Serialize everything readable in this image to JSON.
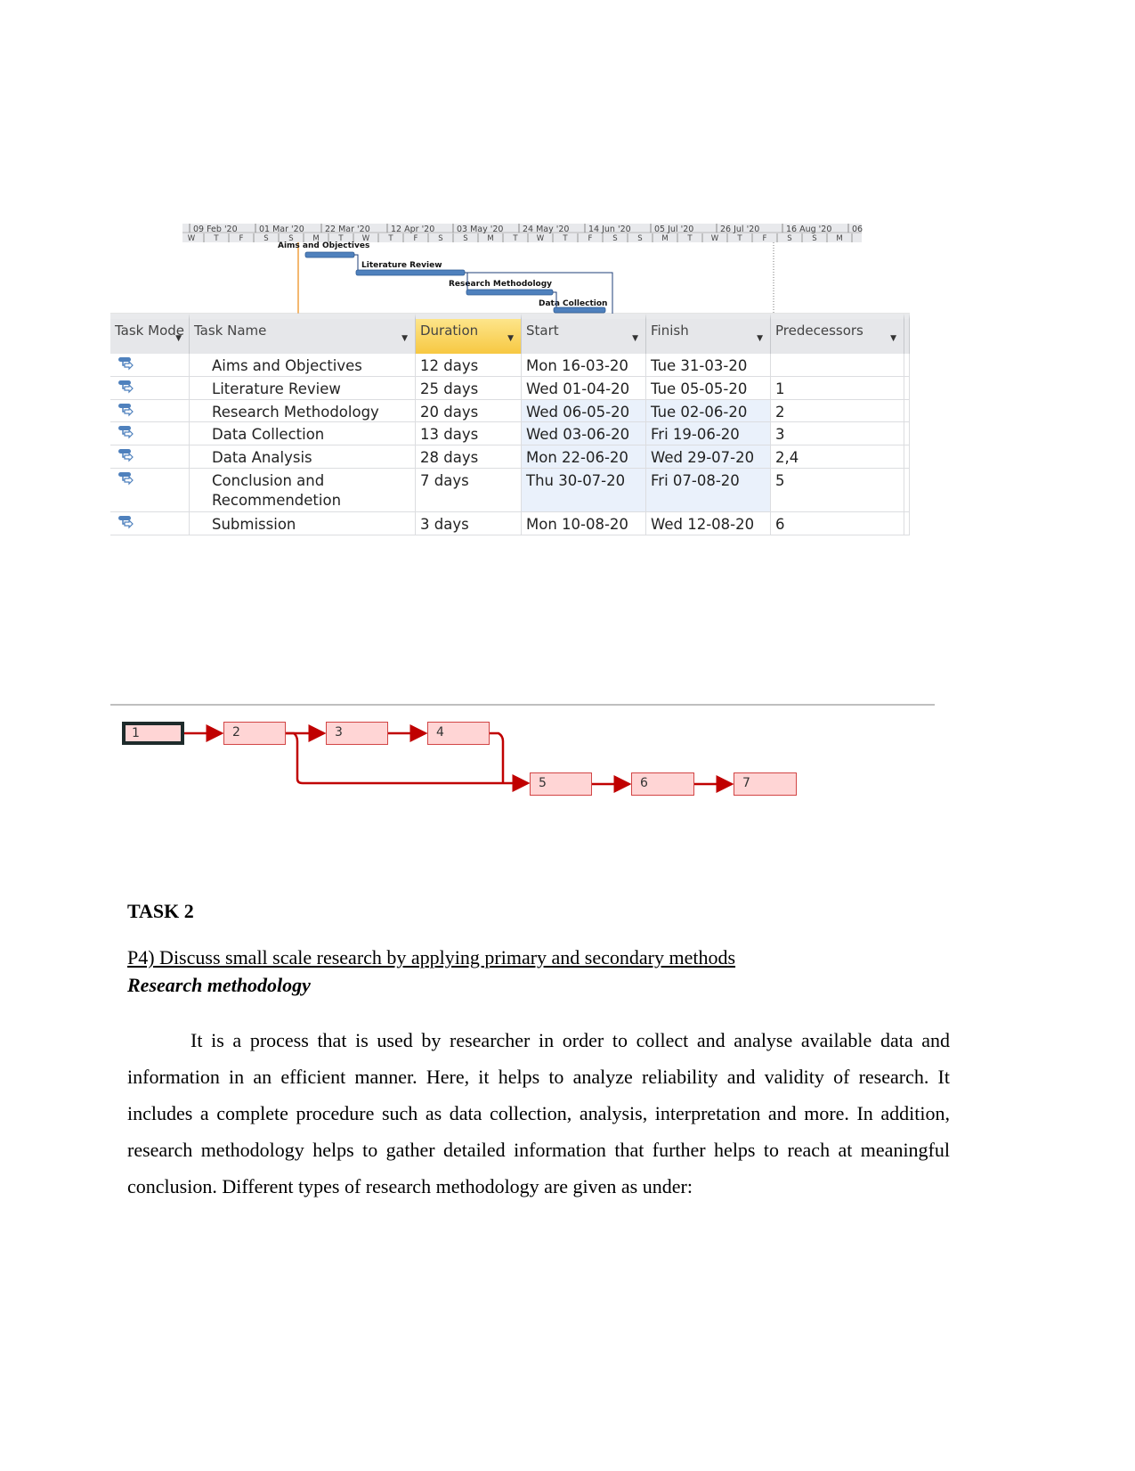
{
  "gantt": {
    "major_ticks": [
      "09 Feb '20",
      "01 Mar '20",
      "22 Mar '20",
      "12 Apr '20",
      "03 May '20",
      "24 May '20",
      "14 Jun '20",
      "05 Jul '20",
      "26 Jul '20",
      "16 Aug '20",
      "06"
    ],
    "minor_ticks": [
      "W",
      "T",
      "F",
      "S",
      "S",
      "M",
      "T",
      "W",
      "T",
      "F",
      "S",
      "S",
      "M",
      "T",
      "W",
      "T",
      "F",
      "S",
      "S",
      "M",
      "T",
      "W",
      "T",
      "F",
      "S",
      "S",
      "M"
    ],
    "bar_labels": [
      "Aims and Objectives",
      "Literature Review",
      "Research Methodology",
      "Data Collection"
    ],
    "colors": {
      "bar": "#4f81bd",
      "today_line": "#f0a040",
      "link": "#1f3f7a"
    }
  },
  "table": {
    "headers": {
      "task_mode": "Task Mode",
      "task_name": "Task Name",
      "duration": "Duration",
      "start": "Start",
      "finish": "Finish",
      "predecessors": "Predecessors"
    },
    "rows": [
      {
        "name": "Aims and Objectives",
        "duration": "12 days",
        "start": "Mon 16-03-20",
        "finish": "Tue 31-03-20",
        "pred": ""
      },
      {
        "name": "Literature Review",
        "duration": "25 days",
        "start": "Wed 01-04-20",
        "finish": "Tue 05-05-20",
        "pred": "1"
      },
      {
        "name": "Research Methodology",
        "duration": "20 days",
        "start": "Wed 06-05-20",
        "finish": "Tue 02-06-20",
        "pred": "2"
      },
      {
        "name": "Data Collection",
        "duration": "13 days",
        "start": "Wed 03-06-20",
        "finish": "Fri 19-06-20",
        "pred": "3"
      },
      {
        "name": "Data Analysis",
        "duration": "28 days",
        "start": "Mon 22-06-20",
        "finish": "Wed 29-07-20",
        "pred": "2,4"
      },
      {
        "name": "Conclusion and Recommendetion",
        "duration": "7 days",
        "start": "Thu 30-07-20",
        "finish": "Fri 07-08-20",
        "pred": "5"
      },
      {
        "name": "Submission",
        "duration": "3 days",
        "start": "Mon 10-08-20",
        "finish": "Wed 12-08-20",
        "pred": "6"
      }
    ]
  },
  "network": {
    "nodes": [
      "1",
      "2",
      "3",
      "4",
      "5",
      "6",
      "7"
    ],
    "colors": {
      "box_fill": "#ffd5d5",
      "line": "#c00000"
    }
  },
  "document": {
    "task_heading": "TASK 2",
    "p4_heading": "P4) Discuss small scale research by applying primary and secondary methods",
    "sub_heading": "Research methodology",
    "paragraph": "It is a process that is used by researcher in order to collect and analyse available data and information in an efficient manner. Here, it helps to analyze reliability and validity of research. It includes a complete procedure such as data collection, analysis, interpretation and more. In addition, research methodology helps to gather detailed information that further helps to reach at meaningful conclusion. Different types of research methodology are given as under:"
  }
}
